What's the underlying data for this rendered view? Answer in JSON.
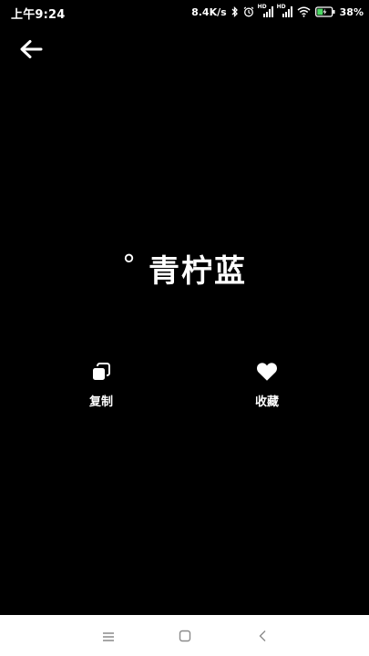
{
  "status_bar": {
    "time": "上午9:24",
    "net_speed": "8.4K/s",
    "battery": "38%",
    "icons": [
      "bluetooth-icon",
      "alarm-icon",
      "signal-icon",
      "signal-icon",
      "wifi-icon",
      "battery-charging-icon"
    ],
    "sim_labels": [
      "HD",
      "HD"
    ]
  },
  "header": {
    "back_icon": "arrow-left-icon"
  },
  "main": {
    "degree_symbol": "°",
    "color_name": "青柠蓝"
  },
  "actions": {
    "copy": {
      "label": "复制",
      "icon": "copy-icon"
    },
    "favorite": {
      "label": "收藏",
      "icon": "heart-icon"
    }
  },
  "nav_bar": {
    "icons": [
      "menu-icon",
      "home-square-icon",
      "back-chevron-icon"
    ]
  },
  "colors": {
    "background": "#000000",
    "foreground": "#ffffff",
    "nav_background": "#ffffff",
    "nav_icon": "#8a8a8a"
  }
}
